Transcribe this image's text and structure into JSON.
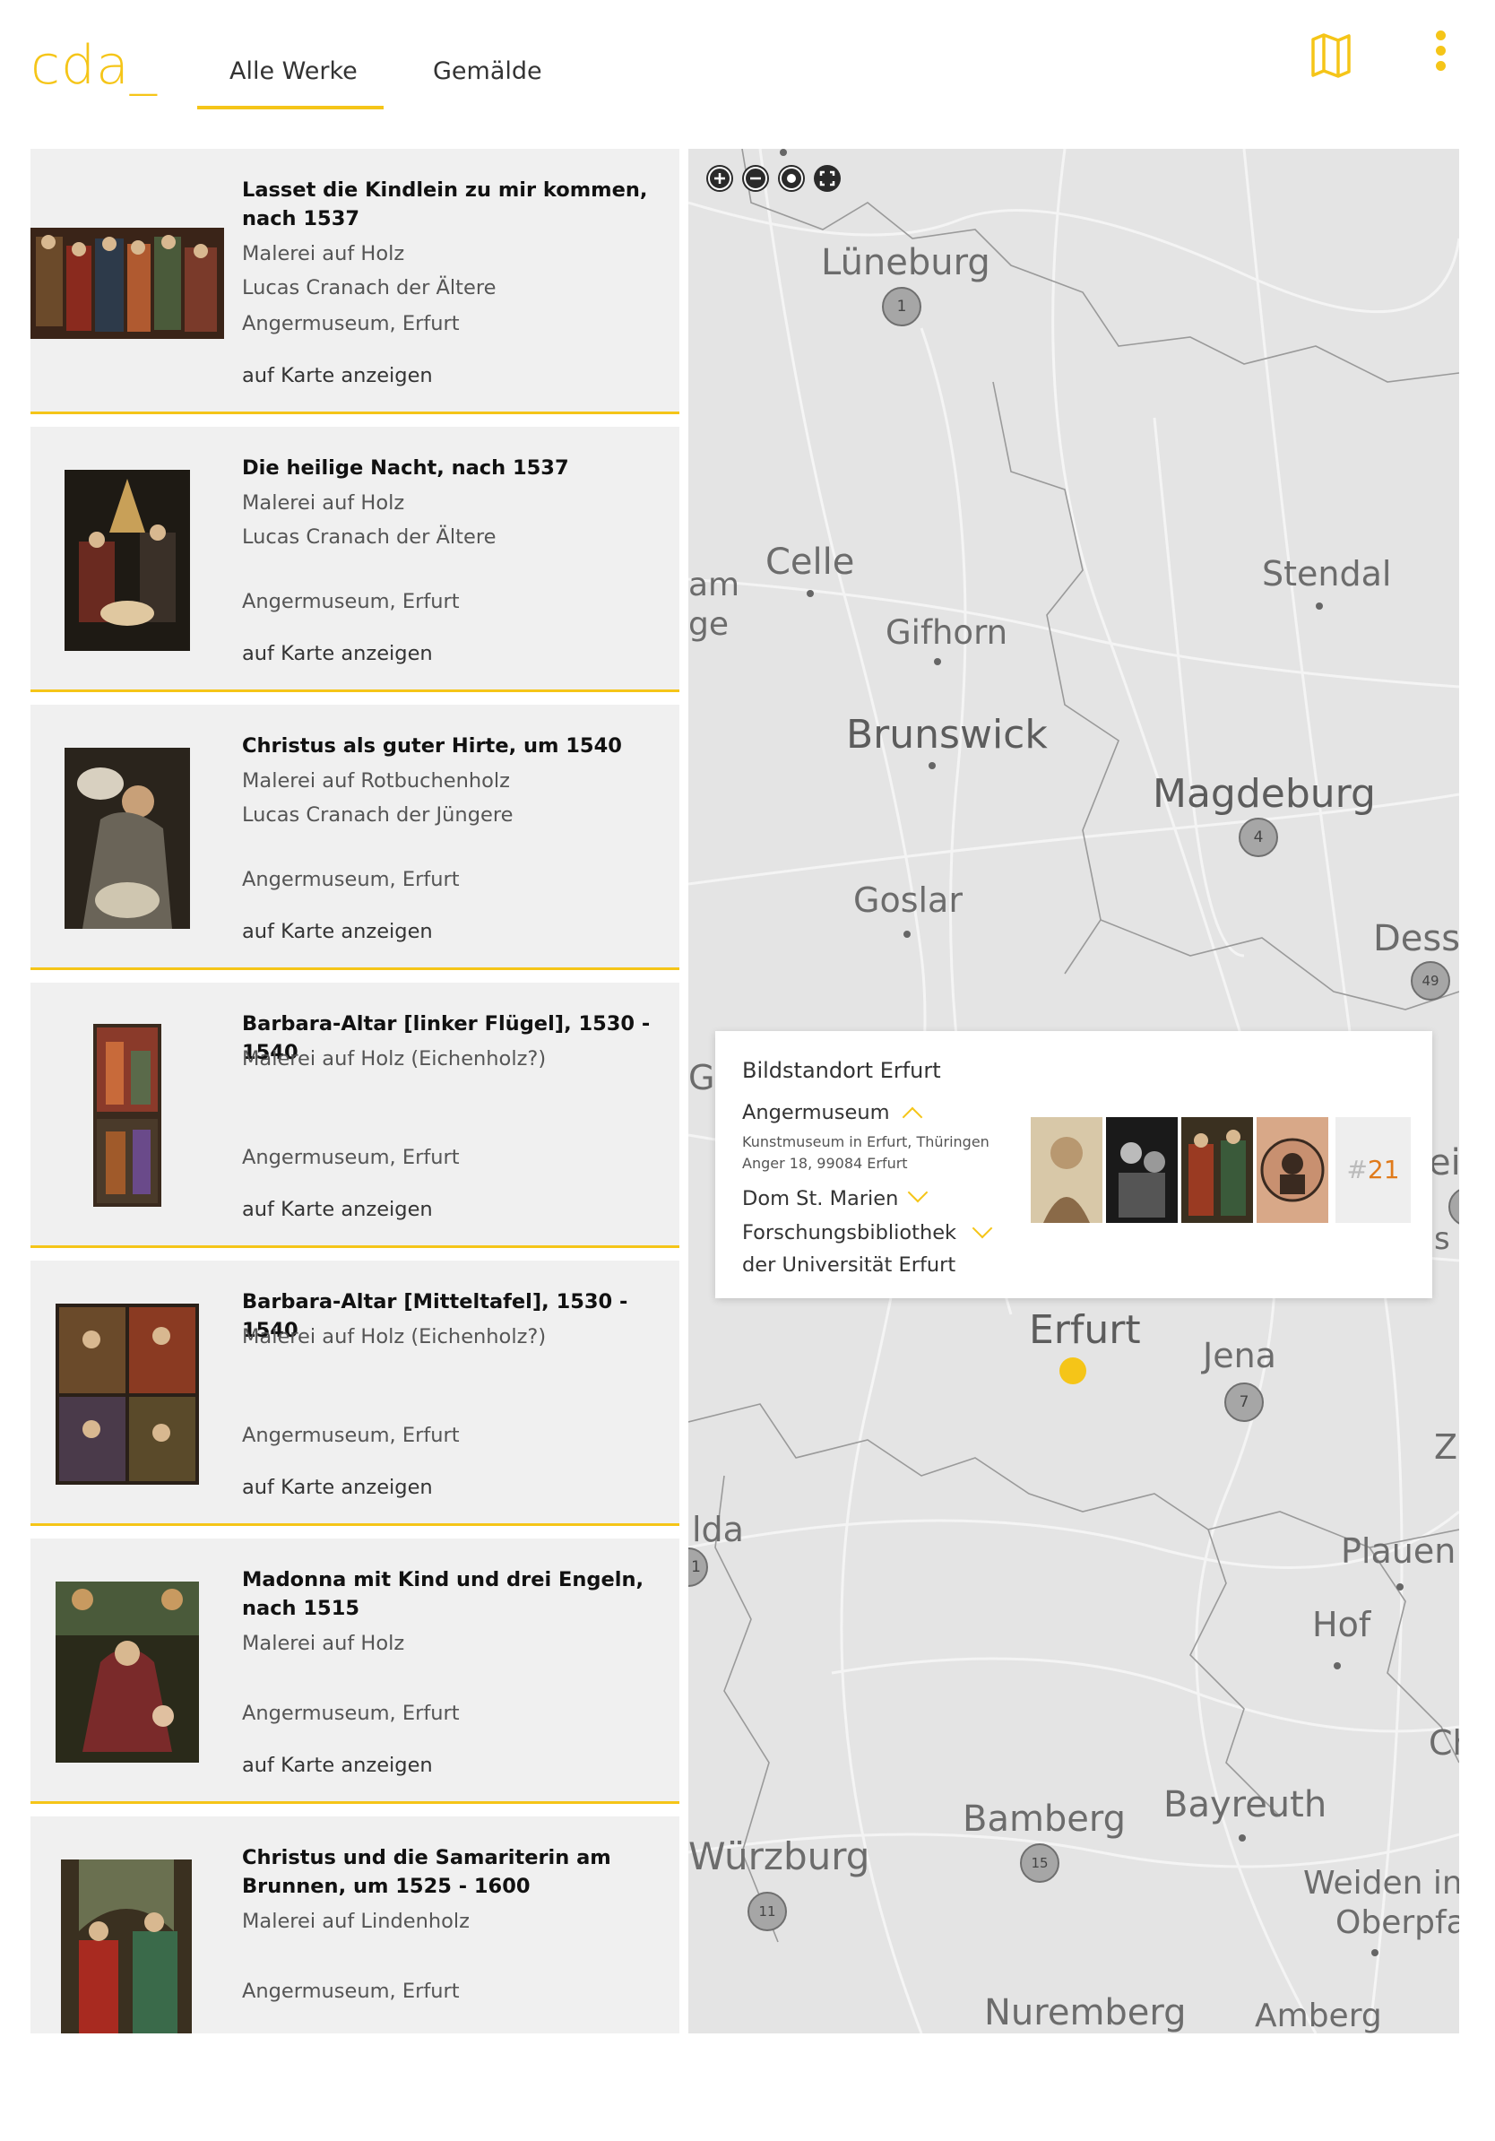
{
  "header": {
    "logo": "cda_",
    "tabs": [
      {
        "label": "Alle Werke",
        "active": true
      },
      {
        "label": "Gemälde",
        "active": false
      }
    ],
    "icons": [
      "map-icon",
      "more-vertical-icon"
    ]
  },
  "colors": {
    "accent": "#f5c518",
    "card_bg": "#f0f0f0",
    "count_color": "#e07a1a"
  },
  "works": [
    {
      "title": "Lasset die Kindlein zu mir kommen, nach 1537",
      "technique": "Malerei auf Holz",
      "artist": "Lucas Cranach der Ältere",
      "location": "Angermuseum, Erfurt",
      "link": "auf Karte anzeigen"
    },
    {
      "title": "Die heilige Nacht, nach 1537",
      "technique": "Malerei auf Holz",
      "artist": "Lucas Cranach der Ältere",
      "location": "Angermuseum, Erfurt",
      "link": "auf Karte anzeigen"
    },
    {
      "title": "Christus als guter Hirte, um 1540",
      "technique": "Malerei auf Rotbuchenholz",
      "artist": "Lucas Cranach der Jüngere",
      "location": "Angermuseum, Erfurt",
      "link": "auf Karte anzeigen"
    },
    {
      "title": "Barbara-Altar [linker Flügel], 1530 - 1540",
      "technique": "Malerei auf Holz (Eichenholz?)",
      "artist": "",
      "location": "Angermuseum, Erfurt",
      "link": "auf Karte anzeigen"
    },
    {
      "title": "Barbara-Altar [Mitteltafel], 1530 - 1540",
      "technique": "Malerei auf Holz (Eichenholz?)",
      "artist": "",
      "location": "Angermuseum, Erfurt",
      "link": "auf Karte anzeigen"
    },
    {
      "title": "Madonna mit Kind und drei Engeln, nach 1515",
      "technique": "Malerei auf Holz",
      "artist": "",
      "location": "Angermuseum, Erfurt",
      "link": "auf Karte anzeigen"
    },
    {
      "title": "Christus und die Samariterin am Brunnen, um 1525 - 1600",
      "technique": "Malerei auf Lindenholz",
      "artist": "",
      "location": "Angermuseum, Erfurt",
      "link": ""
    }
  ],
  "map": {
    "controls": [
      "zoom-in-icon",
      "zoom-out-icon",
      "locate-icon",
      "fullscreen-icon"
    ],
    "cities": [
      "Lüneburg",
      "Celle",
      "Stendal",
      "Gifhorn",
      "Brunswick",
      "Magdeburg",
      "Goslar",
      "Dessa",
      "Erfurt",
      "Jena",
      "Plauen",
      "Hof",
      "Bamberg",
      "Bayreuth",
      "Würzburg",
      "Weiden in",
      "Oberpfa",
      "Nuremberg",
      "Amberg",
      "am",
      "ge",
      "Gö",
      "lda",
      "Z",
      "Ch",
      "ei",
      "s"
    ],
    "clusters": [
      "1",
      "4",
      "49",
      "7",
      "1",
      "15",
      "11"
    ],
    "popup": {
      "title": "Bildstandort Erfurt",
      "museum": "Angermuseum",
      "museum_desc": "Kunstmuseum in Erfurt, Thüringen",
      "museum_address": "Anger 18, 99084 Erfurt",
      "other1": "Dom St. Marien",
      "other2_line1": "Forschungsbibliothek",
      "other2_line2": "der Universität Erfurt",
      "count_hash": "#",
      "count": "21"
    }
  }
}
